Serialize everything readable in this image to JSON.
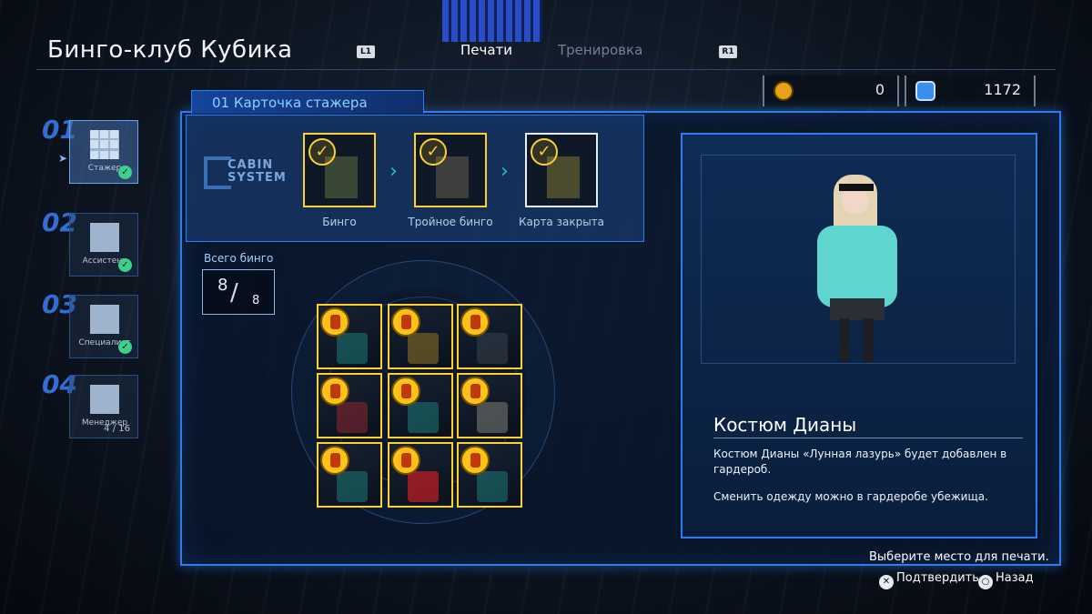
{
  "header": {
    "title": "Бинго-клуб Кубика",
    "left_button": "L1",
    "right_button": "R1",
    "tabs": [
      {
        "label": "Печати",
        "active": true
      },
      {
        "label": "Тренировка",
        "active": false
      }
    ]
  },
  "currencies": [
    {
      "icon": "medal-coin-icon",
      "value": "0"
    },
    {
      "icon": "blue-token-icon",
      "value": "1172"
    }
  ],
  "sidebar": {
    "items": [
      {
        "number": "01",
        "label": "Стажер",
        "completed": true,
        "active": true
      },
      {
        "number": "02",
        "label": "Ассистент",
        "completed": true,
        "active": false
      },
      {
        "number": "03",
        "label": "Специалист",
        "completed": true,
        "active": false
      },
      {
        "number": "04",
        "label": "Менеджер",
        "completed": false,
        "active": false,
        "progress": "4 / 16"
      }
    ]
  },
  "card": {
    "tab_label": "01 Карточка стажера",
    "logo": "CABIN SYSTEM",
    "rewards": [
      {
        "label": "Бинго",
        "claimed": true
      },
      {
        "label": "Тройное бинго",
        "claimed": true
      },
      {
        "label": "Карта закрыта",
        "claimed": true,
        "selected": true
      }
    ],
    "total_label": "Всего бинго",
    "total_current": "8",
    "total_max": "8",
    "grid": [
      {
        "stamped": true,
        "art": "teal"
      },
      {
        "stamped": true,
        "art": "gold"
      },
      {
        "stamped": true,
        "art": "teal"
      },
      {
        "stamped": true,
        "art": "red"
      },
      {
        "stamped": true,
        "art": "teal"
      },
      {
        "stamped": true,
        "art": "teal"
      },
      {
        "stamped": true,
        "art": "teal"
      },
      {
        "stamped": true,
        "art": "red"
      },
      {
        "stamped": true,
        "art": "teal"
      }
    ]
  },
  "detail": {
    "title": "Костюм Дианы",
    "description": "Костюм Дианы «Лунная лазурь» будет добавлен в гардероб.",
    "note": "Сменить одежду можно в гардеробе убежища."
  },
  "footer": {
    "prompt": "Выберите место для печати.",
    "confirm_label": "Подтвердить",
    "back_label": "Назад",
    "confirm_button": "✕",
    "back_button": "○"
  },
  "colors": {
    "accent_blue": "#2c7df0",
    "stamp_gold": "#ffd02b",
    "check_green": "#3ecf8e",
    "chevron_teal": "#29c2b8"
  }
}
